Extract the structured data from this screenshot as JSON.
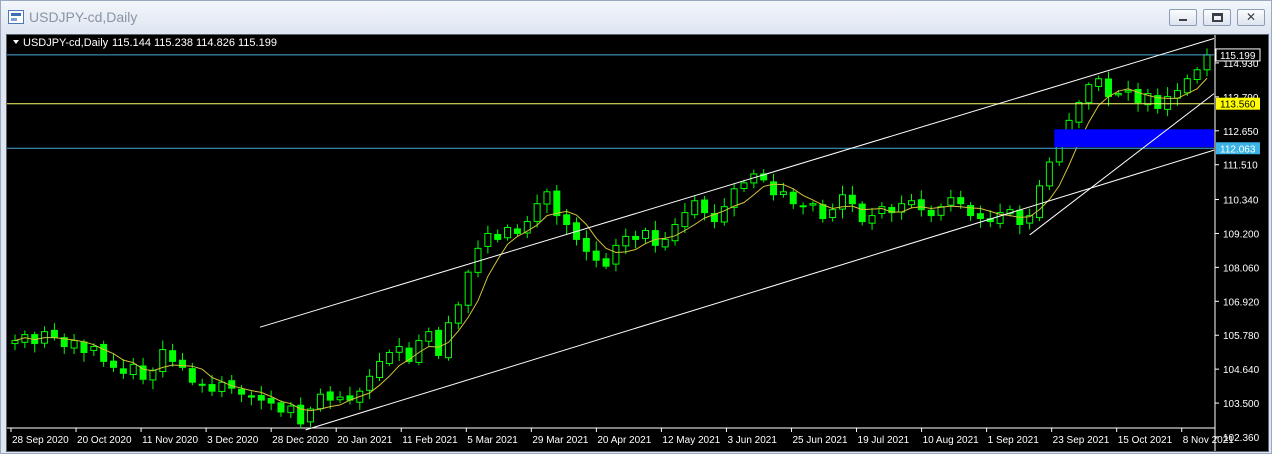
{
  "window": {
    "title": "USDJPY-cd,Daily",
    "buttons": {
      "minimize_icon": "minimize-icon",
      "maximize_icon": "maximize-icon",
      "close_icon": "close-icon",
      "close_glyph": "✕"
    }
  },
  "chart_header": {
    "symbol": "USDJPY-cd,Daily",
    "ohlc": "115.144 115.238 114.826 115.199"
  },
  "colors": {
    "background": "#000000",
    "candle": "#00ff00",
    "moving_average": "#d4c33a",
    "channel": "#ffffff",
    "hline_blue": "#4aa8d8",
    "hline_yellow": "#ffff66",
    "zone": "#0000ff",
    "current_price_label": "#ffffff",
    "yellow_label_bg": "#ffff00",
    "blue_label_bg": "#3bb3e6"
  },
  "chart_data": {
    "type": "candlestick",
    "symbol": "USDJPY-cd",
    "timeframe": "Daily",
    "y_ticks": [
      "114.930",
      "113.790",
      "112.650",
      "111.510",
      "110.340",
      "109.200",
      "108.060",
      "106.920",
      "105.780",
      "104.640",
      "103.500",
      "102.360"
    ],
    "ylim": [
      102.36,
      115.6
    ],
    "x_labels": [
      "28 Sep 2020",
      "20 Oct 2020",
      "11 Nov 2020",
      "3 Dec 2020",
      "28 Dec 2020",
      "20 Jan 2021",
      "11 Feb 2021",
      "5 Mar 2021",
      "29 Mar 2021",
      "20 Apr 2021",
      "12 May 2021",
      "3 Jun 2021",
      "25 Jun 2021",
      "19 Jul 2021",
      "10 Aug 2021",
      "1 Sep 2021",
      "23 Sep 2021",
      "15 Oct 2021",
      "8 Nov 2021"
    ],
    "price_labels": {
      "current": "115.199",
      "yellow_line": "113.560",
      "blue_line": "112.063"
    },
    "horizontal_lines": [
      {
        "name": "blue_top",
        "price": 115.199
      },
      {
        "name": "yellow",
        "price": 113.56
      },
      {
        "name": "blue_bottom",
        "price": 112.063
      }
    ],
    "zone": {
      "from_price": 112.1,
      "to_price": 112.7,
      "start_date": "22 Sep 2021"
    },
    "closes": [
      105.6,
      105.8,
      105.5,
      105.9,
      105.7,
      105.4,
      105.6,
      105.2,
      105.4,
      104.9,
      104.7,
      104.5,
      104.8,
      104.3,
      104.6,
      105.3,
      104.9,
      104.7,
      104.2,
      104.1,
      103.9,
      104.2,
      104.0,
      103.8,
      103.7,
      103.6,
      103.5,
      103.2,
      103.4,
      102.8,
      103.3,
      103.8,
      103.6,
      103.7,
      103.6,
      103.9,
      104.4,
      104.9,
      105.2,
      105.4,
      104.9,
      105.6,
      105.9,
      105.1,
      106.2,
      106.8,
      107.9,
      108.7,
      109.2,
      109.0,
      109.4,
      109.2,
      109.6,
      110.2,
      110.6,
      109.8,
      109.5,
      109.0,
      108.6,
      108.3,
      108.1,
      108.8,
      109.1,
      109.0,
      109.3,
      108.8,
      109.0,
      109.5,
      109.9,
      110.3,
      109.9,
      109.6,
      110.1,
      110.7,
      110.9,
      111.2,
      111.0,
      110.5,
      110.6,
      110.2,
      110.1,
      110.2,
      109.7,
      110.0,
      110.5,
      110.2,
      109.6,
      109.8,
      110.1,
      109.9,
      110.2,
      110.3,
      110.0,
      109.8,
      110.1,
      110.4,
      110.2,
      109.8,
      109.7,
      109.6,
      109.9,
      110.0,
      109.5,
      109.8,
      110.8,
      111.6,
      112.3,
      113.0,
      113.6,
      114.2,
      114.4,
      113.8,
      113.9,
      114.0,
      113.6,
      113.9,
      113.4,
      113.8,
      114.0,
      114.4,
      114.7,
      115.2
    ],
    "ma_period_note": "",
    "channel_lines": [
      {
        "from": {
          "date": "25 Dec 2020",
          "price": 102.6
        },
        "to": {
          "date": "22 Nov 2021",
          "price": 112.0
        }
      },
      {
        "from": {
          "date": "25 Dec 2020",
          "price": 106.05
        },
        "to": {
          "date": "22 Nov 2021",
          "price": 115.75
        }
      },
      {
        "from": {
          "date": "17 Sep 2021",
          "price": 109.15
        },
        "to": {
          "date": "22 Nov 2021",
          "price": 113.9
        }
      }
    ]
  }
}
